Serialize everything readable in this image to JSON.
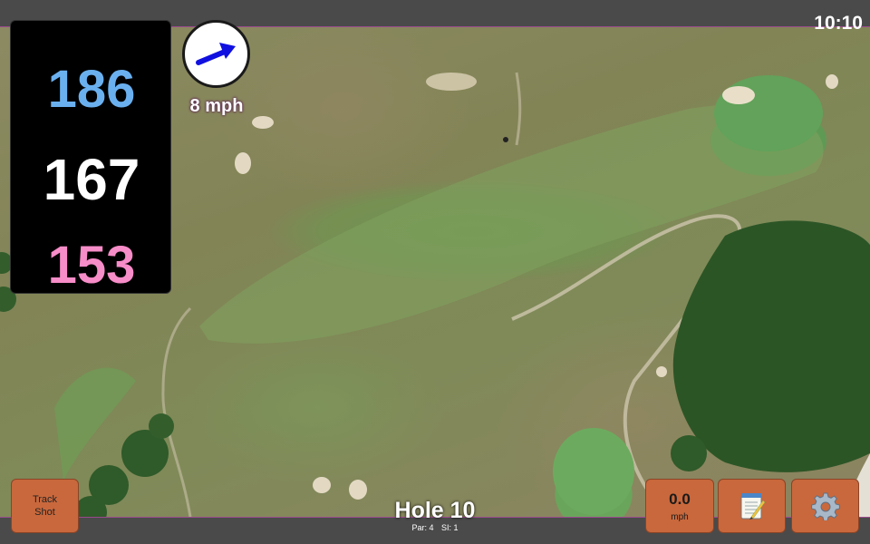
{
  "status": {
    "time": "10:10"
  },
  "distances": {
    "back": "186",
    "middle": "167",
    "front": "153"
  },
  "wind": {
    "speed_label": "8 mph"
  },
  "buttons": {
    "track_shot_line1": "Track",
    "track_shot_line2": "Shot",
    "speed_value": "0.0",
    "speed_unit": "mph",
    "notes_icon": "notepad-icon",
    "settings_icon": "gear-icon"
  },
  "hole": {
    "title": "Hole 10",
    "par": "Par: 4",
    "si": "SI: 1"
  },
  "colors": {
    "back": "#6ab0ef",
    "middle": "#ffffff",
    "front": "#f68cc8",
    "button": "#c9683c",
    "bar": "#4a4a4a",
    "accent": "#9b4a8e"
  }
}
